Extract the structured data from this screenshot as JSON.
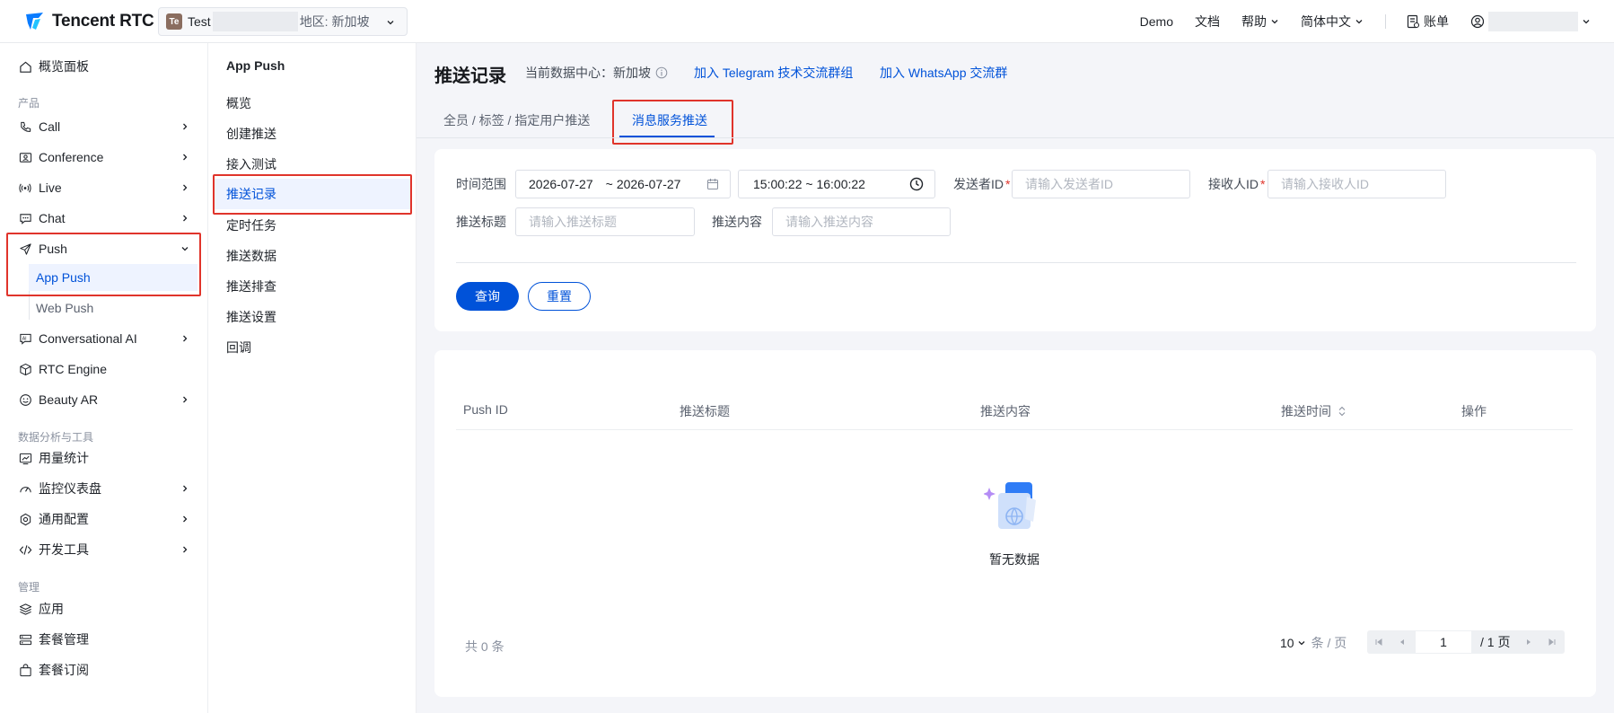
{
  "brand": {
    "name": "Tencent RTC"
  },
  "app_switcher": {
    "avatar": "Te",
    "name": "Test",
    "region": "地区: 新加坡"
  },
  "topnav": {
    "demo": "Demo",
    "docs": "文档",
    "help": "帮助",
    "language": "简体中文",
    "billing": "账单"
  },
  "sidebar": {
    "overview": "概览面板",
    "group_products": "产品",
    "call": "Call",
    "conference": "Conference",
    "live": "Live",
    "chat": "Chat",
    "push": "Push",
    "app_push": "App Push",
    "web_push": "Web Push",
    "conversational_ai": "Conversational AI",
    "rtc_engine": "RTC Engine",
    "beauty_ar": "Beauty AR",
    "group_data": "数据分析与工具",
    "usage": "用量统计",
    "monitor": "监控仪表盘",
    "config": "通用配置",
    "devtools": "开发工具",
    "group_manage": "管理",
    "apps": "应用",
    "packages": "套餐管理",
    "subscription": "套餐订阅"
  },
  "submenu": {
    "title": "App Push",
    "items": [
      "概览",
      "创建推送",
      "接入测试",
      "推送记录",
      "定时任务",
      "推送数据",
      "推送排查",
      "推送设置",
      "回调"
    ]
  },
  "page": {
    "title": "推送记录",
    "data_center_label": "当前数据中心：新加坡",
    "link_telegram": "加入 Telegram 技术交流群组",
    "link_whatsapp": "加入 WhatsApp 交流群"
  },
  "tabs": [
    "全员 / 标签 / 指定用户推送",
    "消息服务推送"
  ],
  "filters": {
    "time_range_label": "时间范围",
    "date_start": "2026-07-27",
    "date_sep": "~",
    "date_end": "2026-07-27",
    "time_range": "15:00:22 ~ 16:00:22",
    "sender_label": "发送者ID",
    "sender_placeholder": "请输入发送者ID",
    "receiver_label": "接收人ID",
    "receiver_placeholder": "请输入接收人ID",
    "title_label": "推送标题",
    "title_placeholder": "请输入推送标题",
    "content_label": "推送内容",
    "content_placeholder": "请输入推送内容",
    "query_button": "查询",
    "reset_button": "重置",
    "required_mark": "*"
  },
  "table": {
    "columns": [
      "Push ID",
      "推送标题",
      "推送内容",
      "推送时间",
      "操作"
    ],
    "rows": [],
    "empty_text": "暂无数据"
  },
  "pagination": {
    "total": "共 0 条",
    "page_size": "10",
    "page_size_unit": "条 / 页",
    "current_page": "1",
    "total_pages": "/ 1 页"
  },
  "colors": {
    "accent": "#0052d9",
    "highlight_box": "#e0342b"
  }
}
